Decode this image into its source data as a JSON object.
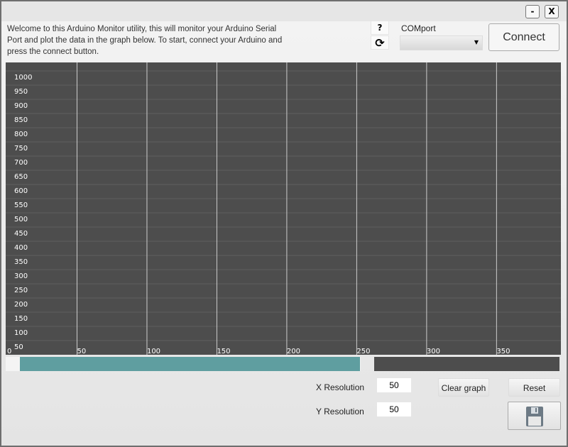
{
  "window": {
    "minimize_label": "-",
    "close_label": "X"
  },
  "intro_text": "Welcome to this Arduino Monitor utility, this will monitor your Arduino Serial Port and plot the data in the graph below. To start, connect your Arduino and press the connect button.",
  "help_label": "?",
  "refresh_icon": "refresh-icon",
  "comport": {
    "label": "COMport",
    "value": ""
  },
  "connect_label": "Connect",
  "chart_data": {
    "type": "line",
    "series": [],
    "x_ticks": [
      0,
      50,
      100,
      150,
      200,
      250,
      300,
      350
    ],
    "y_ticks": [
      50,
      100,
      150,
      200,
      250,
      300,
      350,
      400,
      450,
      500,
      550,
      600,
      650,
      700,
      750,
      800,
      850,
      900,
      950,
      1000
    ],
    "xlim": [
      0,
      395
    ],
    "ylim": [
      50,
      1000
    ],
    "grid": true,
    "colors": {
      "background": "#4d4d4d",
      "grid": "#cccccc",
      "text": "#ffffff"
    }
  },
  "scroll_position": 0.96,
  "controls": {
    "x_resolution_label": "X Resolution",
    "x_resolution": "50",
    "y_resolution_label": "Y Resolution",
    "y_resolution": "50",
    "clear_label": "Clear graph",
    "reset_label": "Reset",
    "save_icon": "floppy-disk-icon"
  },
  "colors": {
    "accent": "#5f9ea0",
    "dark": "#4d4d4d"
  }
}
